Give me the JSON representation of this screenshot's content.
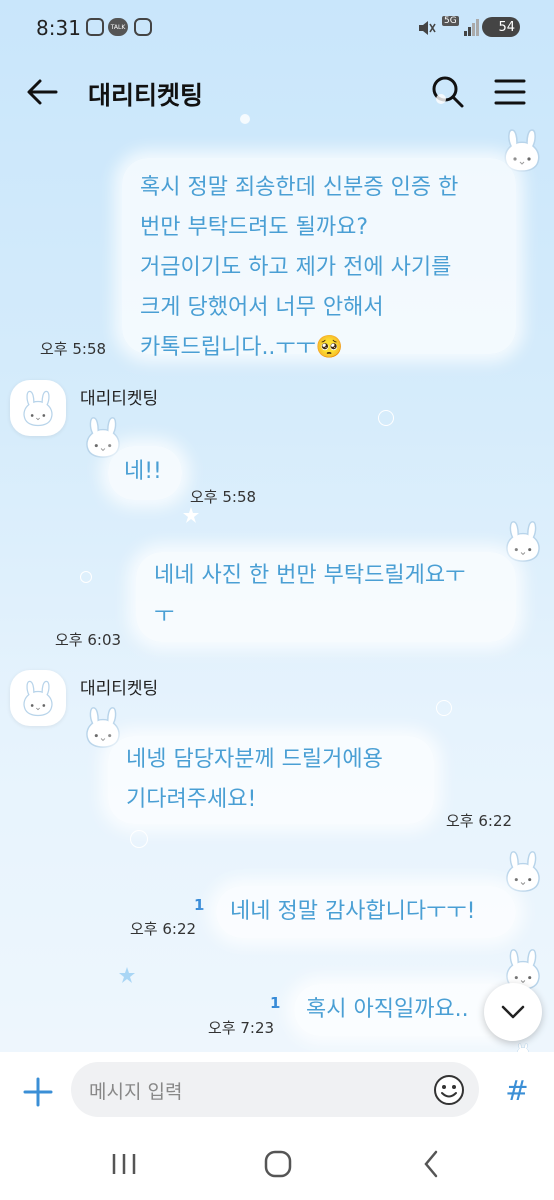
{
  "status_bar": {
    "time": "8:31",
    "talk_label": "TALK",
    "network_label": "5G",
    "battery_level": "54"
  },
  "header": {
    "title": "대리티켓팅"
  },
  "messages": [
    {
      "text": "혹시 정말 죄송한데 신분증 인증 한\n번만 부탁드려도 될까요?\n거금이기도 하고 제가 전에 사기를\n크게 당했어서 너무 안해서\n카톡드립니다..ㅜㅜ🥺",
      "time": "오후 5:58"
    },
    {
      "sender": "대리티켓팅",
      "text": "네!!",
      "time": "오후 5:58"
    },
    {
      "text": "네네 사진 한 번만 부탁드릴게요ㅜ\nㅜ",
      "time": "오후 6:03"
    },
    {
      "sender": "대리티켓팅",
      "text": "네넹 담당자분께 드릴거에용\n기다려주세요!",
      "time": "오후 6:22"
    },
    {
      "text": "네네 정말 감사합니다ㅜㅜ!",
      "time": "오후 6:22",
      "unread": "1"
    },
    {
      "text": "혹시 아직일까요..",
      "time": "오후 7:23",
      "unread": "1"
    }
  ],
  "input": {
    "placeholder": "메시지 입력"
  },
  "colors": {
    "bubble_text": "#4a9fd4",
    "accent": "#3b8fd6"
  }
}
